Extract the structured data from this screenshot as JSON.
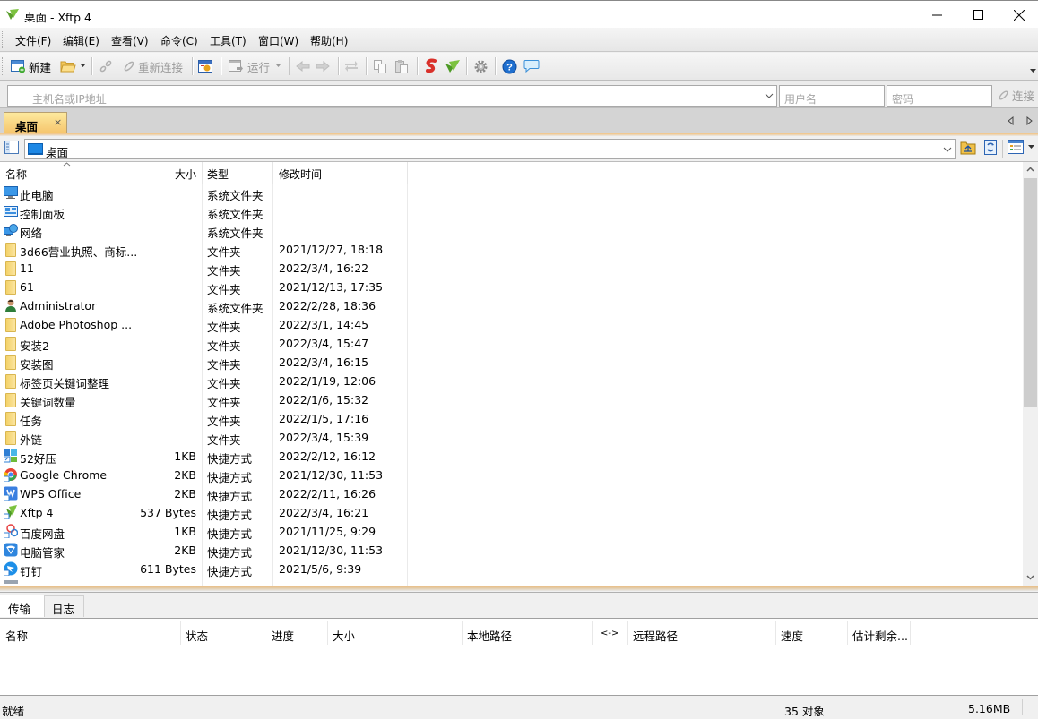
{
  "window": {
    "title": "桌面 - Xftp 4",
    "minimize_icon": "minimize-icon",
    "maximize_icon": "maximize-icon",
    "close_icon": "close-icon"
  },
  "menu": {
    "items": [
      {
        "label": "文件(F)"
      },
      {
        "label": "编辑(E)"
      },
      {
        "label": "查看(V)"
      },
      {
        "label": "命令(C)"
      },
      {
        "label": "工具(T)"
      },
      {
        "label": "窗口(W)"
      },
      {
        "label": "帮助(H)"
      }
    ]
  },
  "toolbar": {
    "new_label": "新建",
    "reconnect_label": "重新连接",
    "run_label": "运行",
    "connect_label": "连接"
  },
  "address": {
    "host_placeholder": "主机名或IP地址",
    "user_placeholder": "用户名",
    "password_placeholder": "密码"
  },
  "tabs": [
    {
      "label": "桌面",
      "close": "×",
      "active": true
    }
  ],
  "path": {
    "current": "桌面"
  },
  "file_list": {
    "columns": {
      "name": "名称",
      "size": "大小",
      "type": "类型",
      "modified": "修改时间"
    },
    "rows": [
      {
        "name": "此电脑",
        "size": "",
        "type": "系统文件夹",
        "modified": "",
        "icon": "computer"
      },
      {
        "name": "控制面板",
        "size": "",
        "type": "系统文件夹",
        "modified": "",
        "icon": "control-panel"
      },
      {
        "name": "网络",
        "size": "",
        "type": "系统文件夹",
        "modified": "",
        "icon": "network"
      },
      {
        "name": "3d66营业执照、商标...",
        "size": "",
        "type": "文件夹",
        "modified": "2021/12/27, 18:18",
        "icon": "folder"
      },
      {
        "name": "11",
        "size": "",
        "type": "文件夹",
        "modified": "2022/3/4, 16:22",
        "icon": "folder"
      },
      {
        "name": "61",
        "size": "",
        "type": "文件夹",
        "modified": "2021/12/13, 17:35",
        "icon": "folder"
      },
      {
        "name": "Administrator",
        "size": "",
        "type": "系统文件夹",
        "modified": "2022/2/28, 18:36",
        "icon": "user"
      },
      {
        "name": "Adobe Photoshop ...",
        "size": "",
        "type": "文件夹",
        "modified": "2022/3/1, 14:45",
        "icon": "folder"
      },
      {
        "name": "安装2",
        "size": "",
        "type": "文件夹",
        "modified": "2022/3/4, 15:47",
        "icon": "folder"
      },
      {
        "name": "安装图",
        "size": "",
        "type": "文件夹",
        "modified": "2022/3/4, 16:15",
        "icon": "folder"
      },
      {
        "name": "标签页关键词整理",
        "size": "",
        "type": "文件夹",
        "modified": "2022/1/19, 12:06",
        "icon": "folder"
      },
      {
        "name": "关键词数量",
        "size": "",
        "type": "文件夹",
        "modified": "2022/1/6, 15:32",
        "icon": "folder"
      },
      {
        "name": "任务",
        "size": "",
        "type": "文件夹",
        "modified": "2022/1/5, 17:16",
        "icon": "folder"
      },
      {
        "name": "外链",
        "size": "",
        "type": "文件夹",
        "modified": "2022/3/4, 15:39",
        "icon": "folder"
      },
      {
        "name": "52好压",
        "size": "1KB",
        "type": "快捷方式",
        "modified": "2022/2/12, 16:12",
        "icon": "shortcut-52haoya"
      },
      {
        "name": "Google Chrome",
        "size": "2KB",
        "type": "快捷方式",
        "modified": "2021/12/30, 11:53",
        "icon": "shortcut-chrome"
      },
      {
        "name": "WPS Office",
        "size": "2KB",
        "type": "快捷方式",
        "modified": "2022/2/11, 16:26",
        "icon": "shortcut-wps"
      },
      {
        "name": "Xftp 4",
        "size": "537 Bytes",
        "type": "快捷方式",
        "modified": "2022/3/4, 16:21",
        "icon": "shortcut-xftp"
      },
      {
        "name": "百度网盘",
        "size": "1KB",
        "type": "快捷方式",
        "modified": "2021/11/25, 9:29",
        "icon": "shortcut-baidu"
      },
      {
        "name": "电脑管家",
        "size": "2KB",
        "type": "快捷方式",
        "modified": "2021/12/30, 11:53",
        "icon": "shortcut-pcmanager"
      },
      {
        "name": "钉钉",
        "size": "611 Bytes",
        "type": "快捷方式",
        "modified": "2021/5/6, 9:39",
        "icon": "shortcut-dingtalk"
      }
    ]
  },
  "bottom_tabs": [
    {
      "label": "传输",
      "active": true
    },
    {
      "label": "日志",
      "active": false
    }
  ],
  "transfer": {
    "columns": [
      "名称",
      "状态",
      "进度",
      "大小",
      "本地路径",
      "<->",
      "远程路径",
      "速度",
      "估计剩余..."
    ]
  },
  "status": {
    "text": "就绪",
    "objects": "35 对象",
    "size": "5.16MB"
  },
  "colors": {
    "tab_active": "#f5c36a",
    "accent_orange": "#f0b772",
    "scroll_thumb": "#cdcdcd"
  }
}
